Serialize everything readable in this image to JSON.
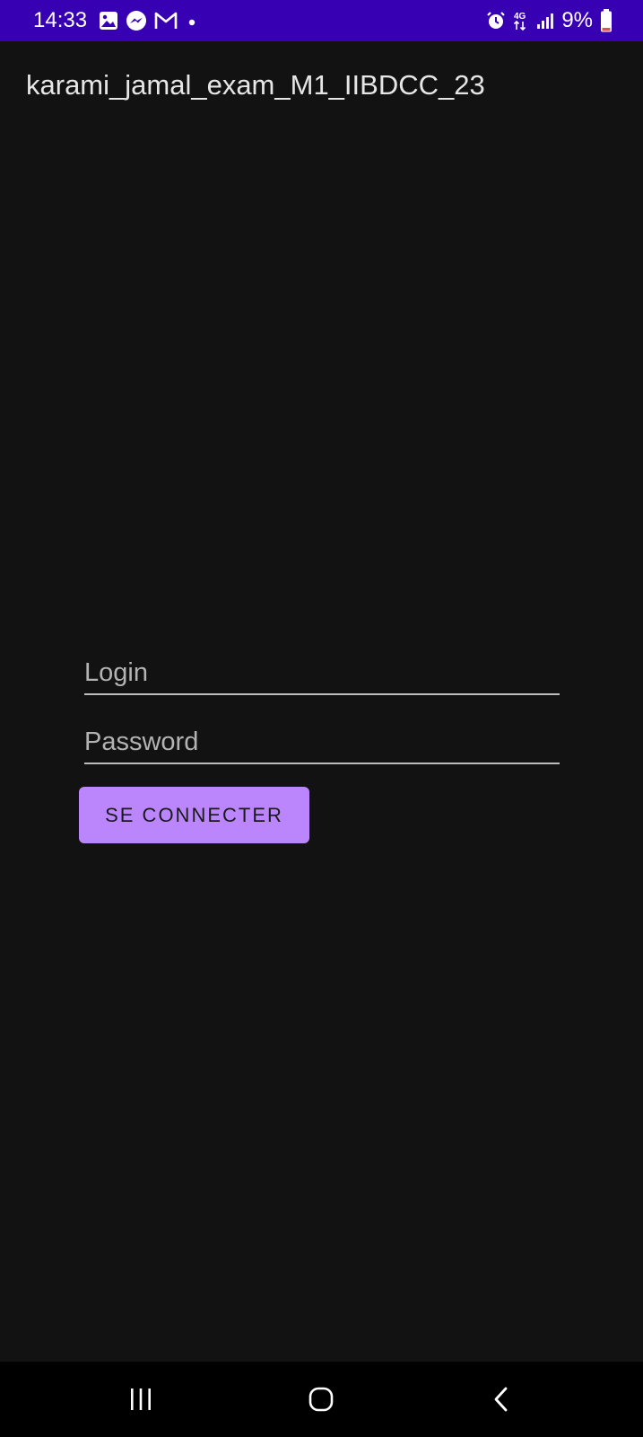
{
  "status_bar": {
    "time": "14:33",
    "left_icons": [
      "gallery-icon",
      "messenger-icon",
      "gmail-icon",
      "dot-icon"
    ],
    "right_icons": [
      "alarm-icon",
      "4g-icon",
      "signal-icon"
    ],
    "battery_text": "9%",
    "network_label": "4G",
    "background": "#3700b3"
  },
  "app_bar": {
    "title": "karami_jamal_exam_M1_IIBDCC_23"
  },
  "form": {
    "login": {
      "placeholder": "Login",
      "value": ""
    },
    "password": {
      "placeholder": "Password",
      "value": ""
    },
    "submit_label": "SE CONNECTER",
    "accent": "#bb86fc"
  },
  "nav_bar": {
    "buttons": [
      "recent-apps-icon",
      "home-icon",
      "back-icon"
    ]
  },
  "colors": {
    "background": "#121212",
    "status_bar": "#3700b3",
    "button": "#bb86fc"
  }
}
